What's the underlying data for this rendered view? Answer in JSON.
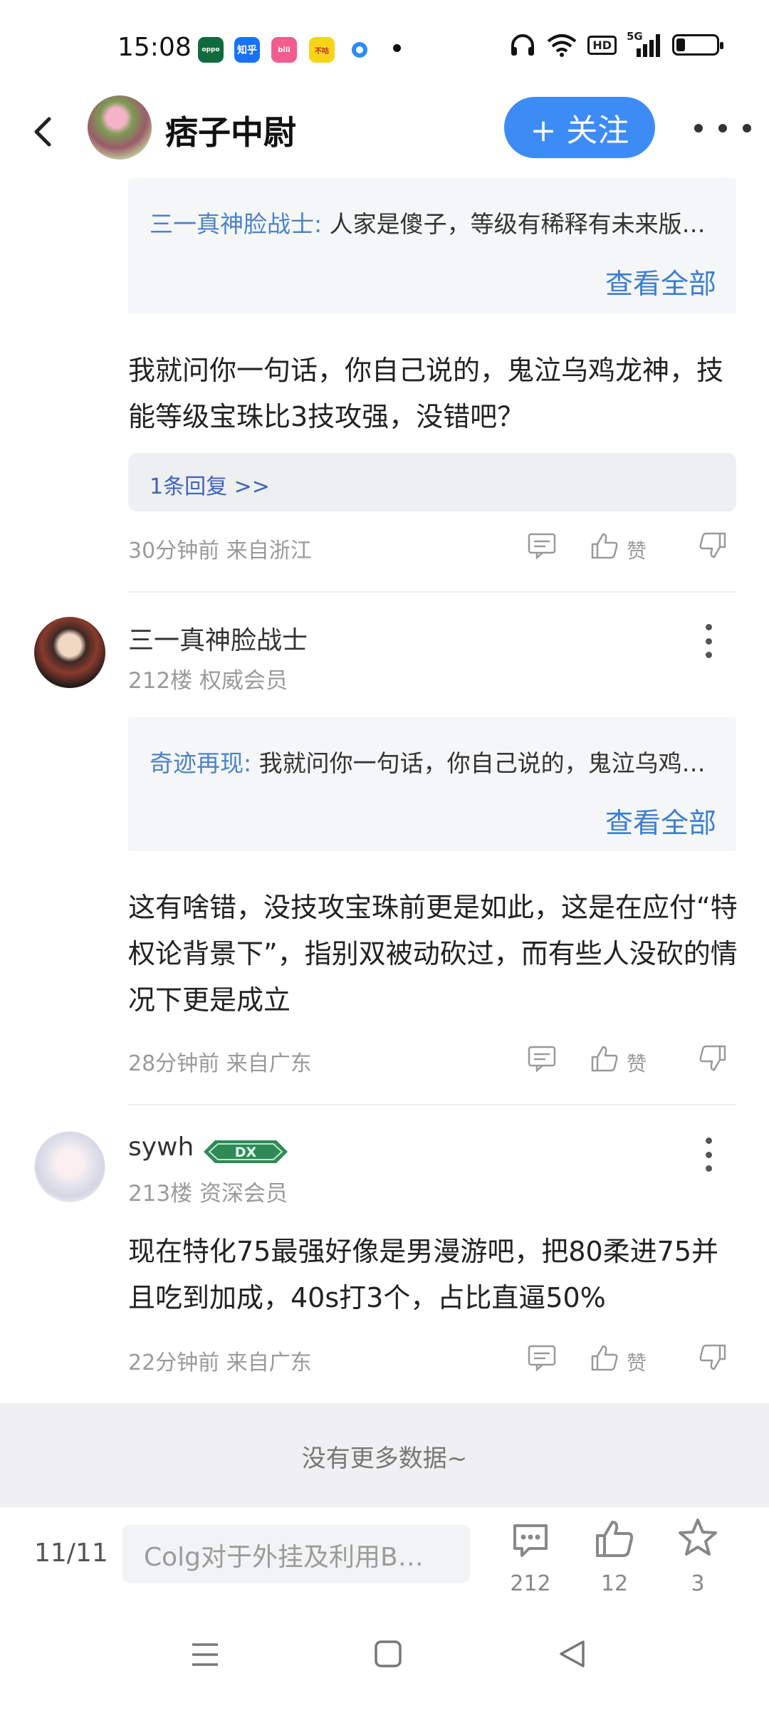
{
  "status_bar": {
    "time": "15:08",
    "apps": [
      "oppo",
      "知乎",
      "bilibili",
      "不咕剑",
      "browser"
    ],
    "network": "5G",
    "hd": "HD",
    "battery_level": 0.15
  },
  "header": {
    "title": "痞子中尉",
    "follow_label": "+ 关注",
    "icons": [
      "back-arrow-icon",
      "more-icon"
    ]
  },
  "thread": {
    "quote1": {
      "author": "三一真神脸战士:",
      "text": " 人家是傻子，等级有稀释有未来版…",
      "view_all": "查看全部"
    },
    "comment1": {
      "text": "我就问你一句话，你自己说的，鬼泣乌鸡龙神，技能等级宝珠比3技攻强，没错吧？",
      "reply_link": "1条回复 >>",
      "meta": "30分钟前 来自浙江",
      "like_label": "赞"
    },
    "comment2": {
      "username": "三一真神脸战士",
      "floor": "212楼 权威会员",
      "quote_author": "奇迹再现:",
      "quote_text": " 我就问你一句话，你自己说的，鬼泣乌鸡…",
      "view_all": "查看全部",
      "text": "这有啥错，没技攻宝珠前更是如此，这是在应付“特权论背景下”，指别双被动砍过，而有些人没砍的情况下更是成立",
      "meta": "28分钟前 来自广东",
      "like_label": "赞"
    },
    "comment3": {
      "username": "sywh",
      "badge": "DX",
      "floor": "213楼 资深会员",
      "text": "现在特化75最强好像是男漫游吧，把80柔进75并且吃到加成，40s打3个，占比直逼50%",
      "meta": "22分钟前 来自广东",
      "like_label": "赞"
    },
    "no_more": "没有更多数据~"
  },
  "bottom_bar": {
    "page": "11/11",
    "input_placeholder": "Colg对于外挂及利用B…",
    "comments_count": "212",
    "likes_count": "12",
    "favorites_count": "3"
  },
  "colors": {
    "accent": "#3d8bf5",
    "link": "#3d7fd0",
    "quote_author": "#4d83c8"
  }
}
